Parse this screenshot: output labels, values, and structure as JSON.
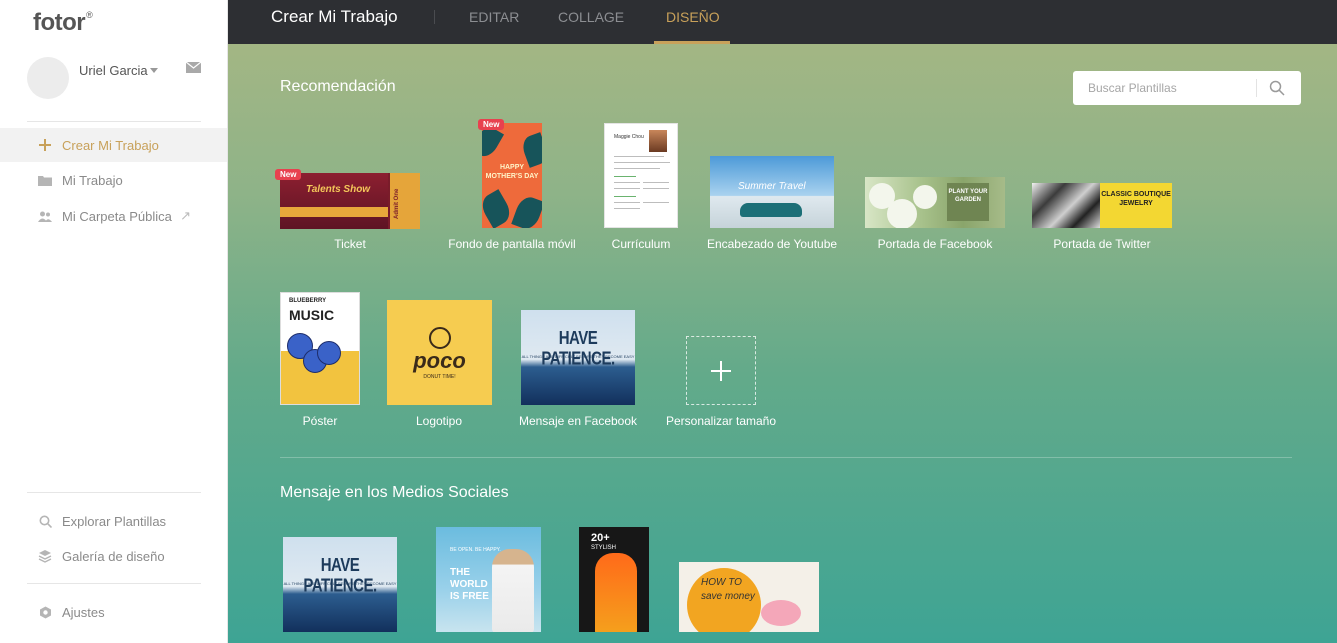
{
  "sidebar": {
    "logo": "fotor",
    "logo_mark": "®",
    "user_name": "Uriel Garcia",
    "nav_items": [
      {
        "label": "Crear Mi Trabajo",
        "icon": "plus-icon"
      },
      {
        "label": "Mi Trabajo",
        "icon": "folder-icon"
      },
      {
        "label": "Mi Carpeta Pública",
        "icon": "users-icon"
      }
    ],
    "bottom_items": [
      {
        "label": "Explorar Plantillas",
        "icon": "search-icon"
      },
      {
        "label": "Galería de diseño",
        "icon": "layers-icon"
      },
      {
        "label": "Ajustes",
        "icon": "gear-icon"
      }
    ]
  },
  "header": {
    "title": "Crear Mi Trabajo",
    "tabs": [
      "EDITAR",
      "COLLAGE",
      "DISEÑO"
    ],
    "active_tab": "DISEÑO"
  },
  "main": {
    "recommendation_title": "Recomendación",
    "search_placeholder": "Buscar Plantillas",
    "templates_row1": [
      {
        "label": "Ticket",
        "badge": "New",
        "thumb_text": "Talents Show",
        "thumb_text2": "Admit One"
      },
      {
        "label": "Fondo de pantalla móvil",
        "badge": "New",
        "thumb_text": "HAPPY MOTHER'S DAY"
      },
      {
        "label": "Currículum",
        "thumb_text": "Maggie Chou"
      },
      {
        "label": "Encabezado de Youtube",
        "thumb_text": "Summer Travel"
      },
      {
        "label": "Portada de Facebook",
        "thumb_text": "PLANT YOUR GARDEN"
      },
      {
        "label": "Portada de Twitter",
        "thumb_text": "CLASSIC BOUTIQUE JEWELRY"
      }
    ],
    "templates_row2": [
      {
        "label": "Póster",
        "thumb_text": "BLUEBERRY",
        "thumb_text2": "MUSIC"
      },
      {
        "label": "Logotipo",
        "thumb_text": "poco",
        "thumb_text2": "DONUT TIME!"
      },
      {
        "label": "Mensaje en Facebook",
        "thumb_text": "HAVE PATIENCE.",
        "thumb_text2": "ALL THINGS ARE DIFFICULT BEFORE THEY BECOME EASY"
      },
      {
        "label": "Personalizar tamaño"
      }
    ],
    "social_title": "Mensaje en los Medios Sociales",
    "social_templates": [
      {
        "thumb_text": "HAVE PATIENCE.",
        "thumb_text2": "ALL THINGS ARE DIFFICULT BEFORE THEY BECOME EASY"
      },
      {
        "thumb_text": "THE WORLD IS FREE",
        "thumb_text2": "BE OPEN. BE HAPPY."
      },
      {
        "thumb_text": "20+",
        "thumb_text2": "STYLISH"
      },
      {
        "thumb_text": "HOW TO save money"
      }
    ]
  },
  "colors": {
    "accent": "#c8a15a",
    "topbar": "#2d2f33",
    "badge": "#e8414f"
  }
}
